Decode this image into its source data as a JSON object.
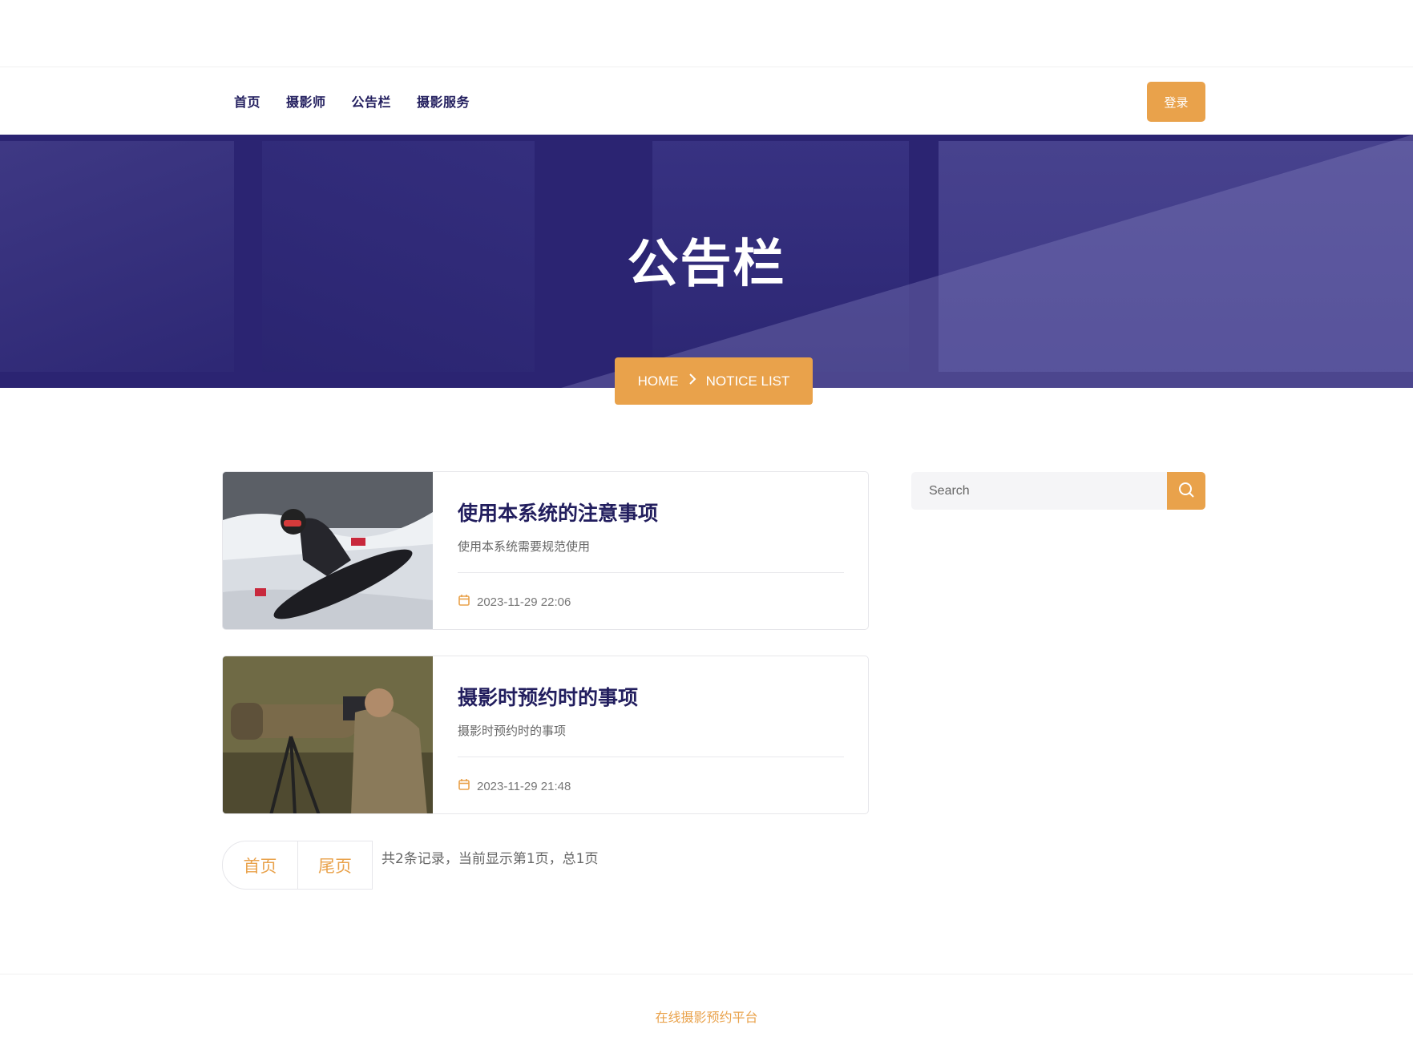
{
  "nav": {
    "links": [
      "首页",
      "摄影师",
      "公告栏",
      "摄影服务"
    ],
    "login": "登录"
  },
  "hero": {
    "title": "公告栏",
    "breadcrumb_home": "HOME",
    "breadcrumb_current": "NOTICE LIST"
  },
  "notices": [
    {
      "title": "使用本系统的注意事项",
      "desc": "使用本系统需要规范使用",
      "date": "2023-11-29 22:06",
      "image": "snowboarder-photo"
    },
    {
      "title": "摄影时预约时的事项",
      "desc": "摄影时预约时的事项",
      "date": "2023-11-29 21:48",
      "image": "photographer-with-telephoto-lens-photo"
    }
  ],
  "search": {
    "placeholder": "Search"
  },
  "pager": {
    "first": "首页",
    "last": "尾页",
    "info": "共2条记录，当前显示第1页，总1页"
  },
  "footer": {
    "text": "在线摄影预约平台"
  },
  "colors": {
    "accent": "#e9a24b",
    "navy": "#221e5e",
    "hero": "#2b2472"
  }
}
